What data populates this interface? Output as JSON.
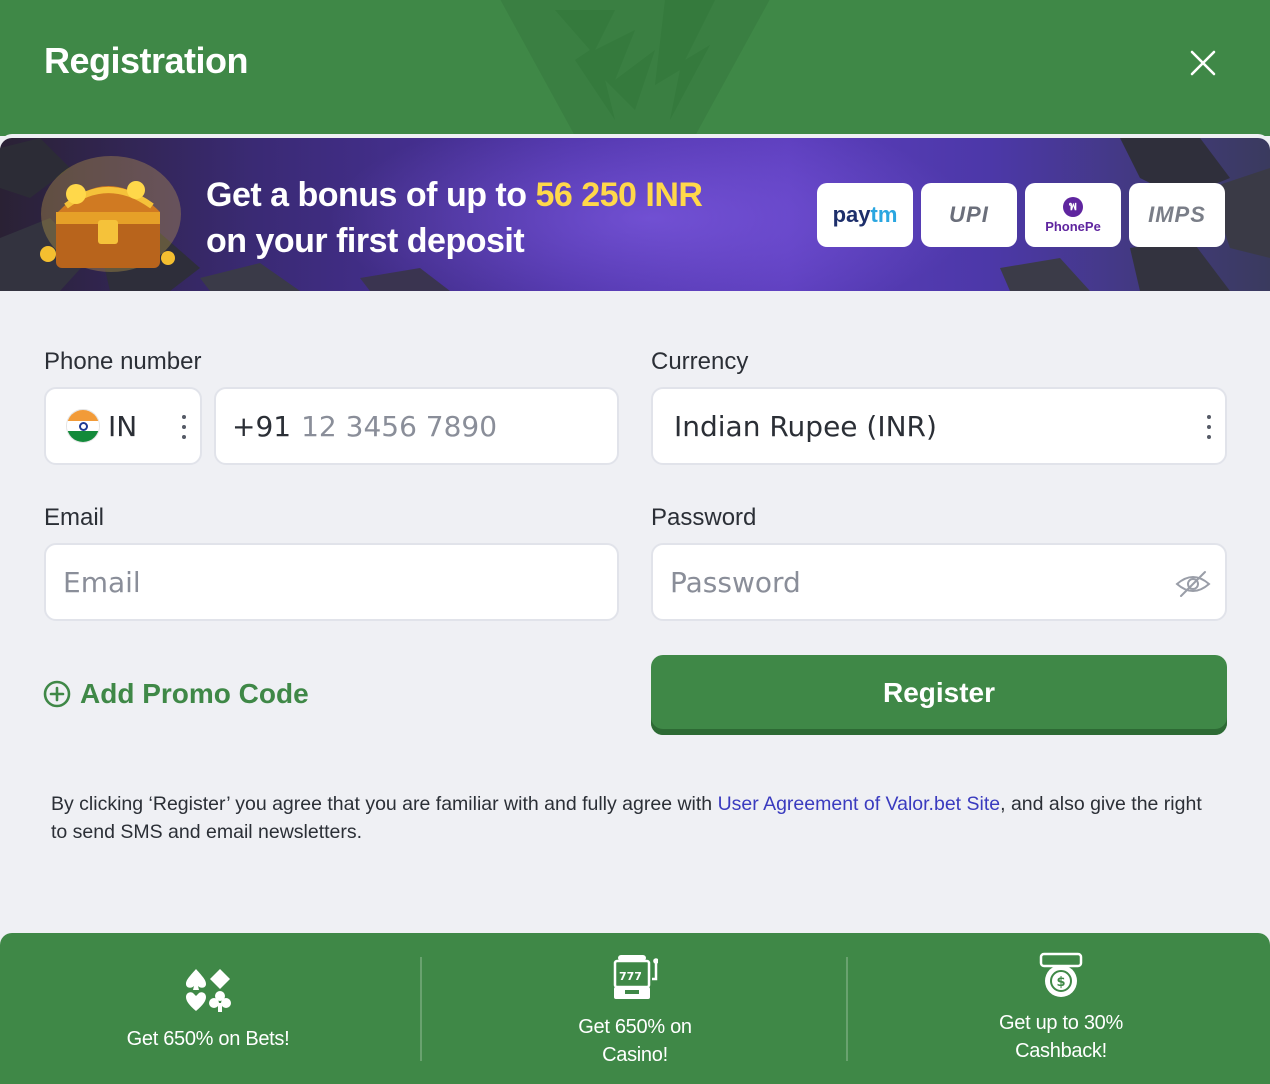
{
  "header": {
    "title": "Registration"
  },
  "banner": {
    "line1_prefix": "Get a bonus of up to ",
    "line1_amount": "56 250 INR",
    "line2": "on your first deposit",
    "payment_logos": [
      {
        "name": "paytm",
        "text_a": "pay",
        "text_b": "tm"
      },
      {
        "name": "upi",
        "text": "UPI"
      },
      {
        "name": "phonepe",
        "text": "PhonePe",
        "symbol": "พ"
      },
      {
        "name": "imps",
        "text": "IMPS"
      }
    ]
  },
  "form": {
    "phone": {
      "label": "Phone number",
      "country_code": "IN",
      "prefix": "+91",
      "placeholder": "12 3456 7890"
    },
    "currency": {
      "label": "Currency",
      "value": "Indian Rupee (INR)"
    },
    "email": {
      "label": "Email",
      "placeholder": "Email"
    },
    "password": {
      "label": "Password",
      "placeholder": "Password"
    },
    "promo_label": "Add Promo Code",
    "register_label": "Register",
    "terms_prefix": "By clicking ‘Register’ you agree that you are familiar with and fully agree with ",
    "terms_link": "User Agreement of Valor.bet Site",
    "terms_suffix": ", and also give the right to send SMS and email newsletters."
  },
  "footer": {
    "features": [
      {
        "icon": "card-suits-icon",
        "text": "Get 650% on Bets!"
      },
      {
        "icon": "slot-machine-icon",
        "text_line1": "Get 650% on",
        "text_line2": "Casino!"
      },
      {
        "icon": "cashback-icon",
        "text_line1": "Get up to 30%",
        "text_line2": "Cashback!"
      }
    ]
  },
  "colors": {
    "brand_green": "#3f8847",
    "link_blue": "#3a3bbf",
    "bonus_yellow": "#ffd84a"
  }
}
